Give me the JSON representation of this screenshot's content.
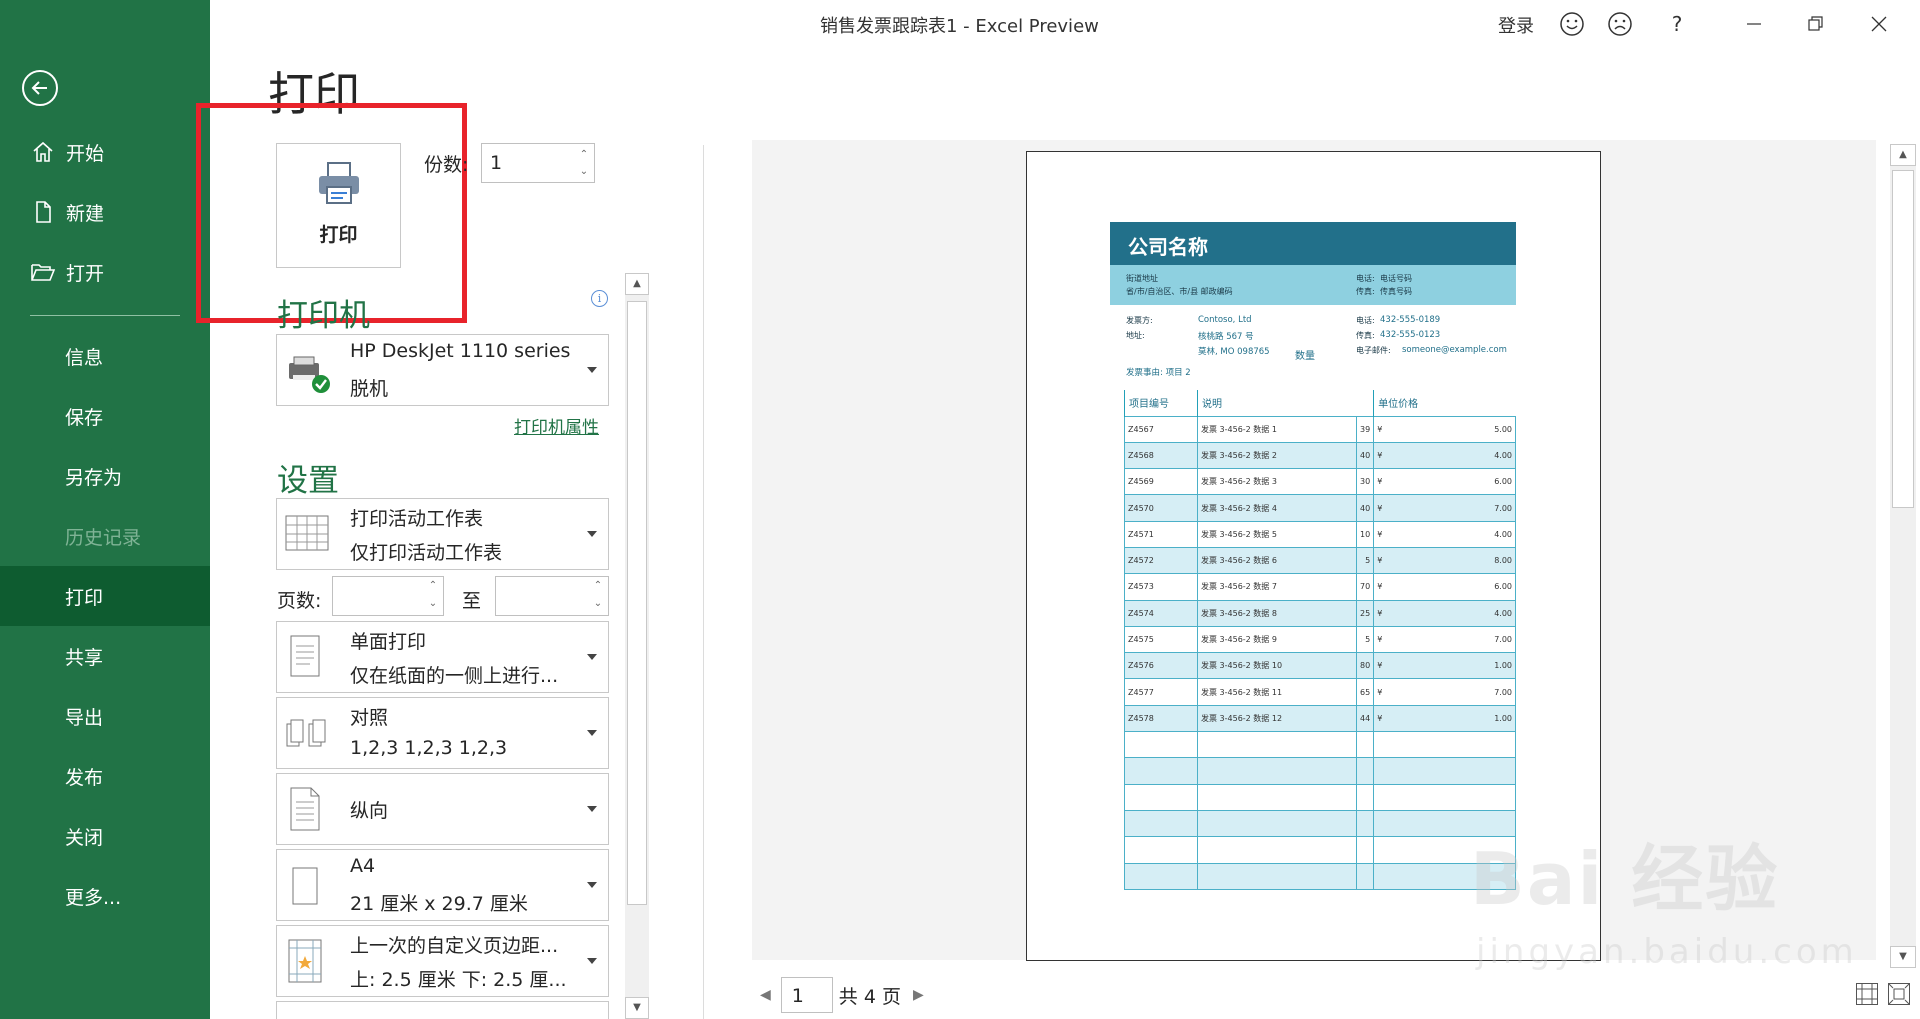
{
  "window": {
    "title": "销售发票跟踪表1  -  Excel Preview",
    "login": "登录",
    "help": "?"
  },
  "nav": {
    "items": [
      {
        "label": "开始",
        "icon": "home-icon"
      },
      {
        "label": "新建",
        "icon": "new-file-icon"
      },
      {
        "label": "打开",
        "icon": "open-folder-icon"
      },
      {
        "label": "信息"
      },
      {
        "label": "保存"
      },
      {
        "label": "另存为"
      },
      {
        "label": "历史记录"
      },
      {
        "label": "打印"
      },
      {
        "label": "共享"
      },
      {
        "label": "导出"
      },
      {
        "label": "发布"
      },
      {
        "label": "关闭"
      },
      {
        "label": "更多..."
      }
    ]
  },
  "print": {
    "heading": "打印",
    "button_label": "打印",
    "copies_label": "份数:",
    "copies_value": "1",
    "printer_heading": "打印机",
    "printer_name": "HP DeskJet 1110 series",
    "printer_status": "脱机",
    "printer_props": "打印机属性",
    "settings_heading": "设置",
    "pages_label": "页数:",
    "to_label": "至",
    "settings": [
      {
        "l1": "打印活动工作表",
        "l2": "仅打印活动工作表"
      },
      {
        "l1": "单面打印",
        "l2": "仅在纸面的一侧上进行..."
      },
      {
        "l1": "对照",
        "l2": "1,2,3    1,2,3    1,2,3"
      },
      {
        "l1": "纵向",
        "l2": ""
      },
      {
        "l1": "A4",
        "l2": "21 厘米 x 29.7 厘米"
      },
      {
        "l1": "上一次的自定义页边距...",
        "l2": "上: 2.5 厘米 下: 2.5 厘..."
      }
    ]
  },
  "preview": {
    "page_current": "1",
    "page_total": "共 4 页",
    "invoice": {
      "company": "公司名称",
      "street": "街道地址",
      "city": "省/市/自治区、市/县  邮政编码",
      "phone_label": "电话:",
      "phone_ph": "电话号码",
      "fax_label": "传真:",
      "fax_ph": "传真号码",
      "to_label": "发票方:",
      "to_value": "Contoso, Ltd",
      "addr_label": "地址:",
      "addr_value": "核桃路 567 号",
      "addr_value2": "莫林, MO 098765",
      "phone2_label": "电话:",
      "phone2_value": "432-555-0189",
      "fax2_label": "传真:",
      "fax2_value": "432-555-0123",
      "email_label": "电子邮件:",
      "email_value": "someone@example.com",
      "reason": "发票事由:  项目 2",
      "columns": [
        "项目编号",
        "说明",
        "数量",
        "单位价格"
      ],
      "rows": [
        [
          "Z4567",
          "发票 3-456-2 数据 1",
          "39",
          "¥",
          "5.00"
        ],
        [
          "Z4568",
          "发票 3-456-2 数据 2",
          "40",
          "¥",
          "4.00"
        ],
        [
          "Z4569",
          "发票 3-456-2 数据 3",
          "30",
          "¥",
          "6.00"
        ],
        [
          "Z4570",
          "发票 3-456-2 数据 4",
          "40",
          "¥",
          "7.00"
        ],
        [
          "Z4571",
          "发票 3-456-2 数据 5",
          "10",
          "¥",
          "4.00"
        ],
        [
          "Z4572",
          "发票 3-456-2 数据 6",
          "5",
          "¥",
          "8.00"
        ],
        [
          "Z4573",
          "发票 3-456-2 数据 7",
          "70",
          "¥",
          "6.00"
        ],
        [
          "Z4574",
          "发票 3-456-2 数据 8",
          "25",
          "¥",
          "4.00"
        ],
        [
          "Z4575",
          "发票 3-456-2 数据 9",
          "5",
          "¥",
          "7.00"
        ],
        [
          "Z4576",
          "发票 3-456-2 数据 10",
          "80",
          "¥",
          "1.00"
        ],
        [
          "Z4577",
          "发票 3-456-2 数据 11",
          "65",
          "¥",
          "7.00"
        ],
        [
          "Z4578",
          "发票 3-456-2 数据 12",
          "44",
          "¥",
          "1.00"
        ]
      ]
    }
  },
  "watermark": {
    "big": "Bai 经验",
    "small": "jingyan.baidu.com"
  },
  "colors": {
    "brand": "#217346",
    "highlight": "#e8232b",
    "invoice_header": "#22708a",
    "invoice_band": "#8ed0e0"
  }
}
